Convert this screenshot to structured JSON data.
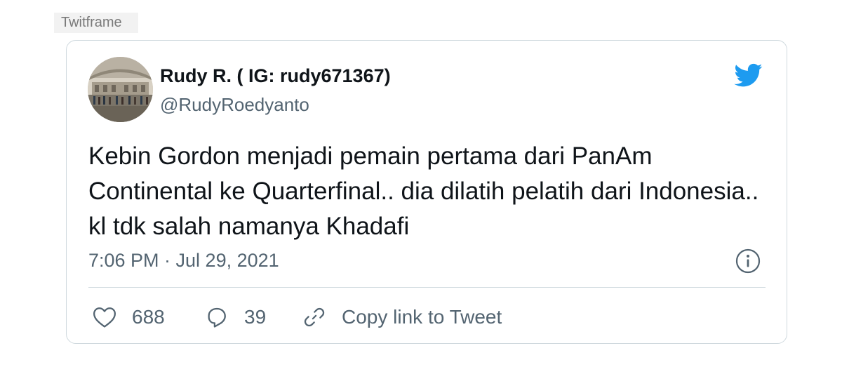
{
  "frame": {
    "label": "Twitframe"
  },
  "author": {
    "name": "Rudy R. ( IG: rudy671367)",
    "handle": "@RudyRoedyanto"
  },
  "tweet": {
    "text": "Kebin Gordon menjadi pemain pertama dari PanAm Continental ke Quarterfinal.. dia dilatih pelatih dari Indonesia.. kl tdk salah namanya Khadafi",
    "timestamp": "7:06 PM · Jul 29, 2021"
  },
  "actions": {
    "likes": "688",
    "replies": "39",
    "copy_link_label": "Copy link to Tweet"
  },
  "colors": {
    "twitter_blue": "#1d9bf0",
    "secondary_text": "#536471",
    "border": "#cfd9de"
  },
  "icons": [
    "twitter-bird-icon",
    "info-icon",
    "heart-icon",
    "reply-icon",
    "link-icon"
  ]
}
